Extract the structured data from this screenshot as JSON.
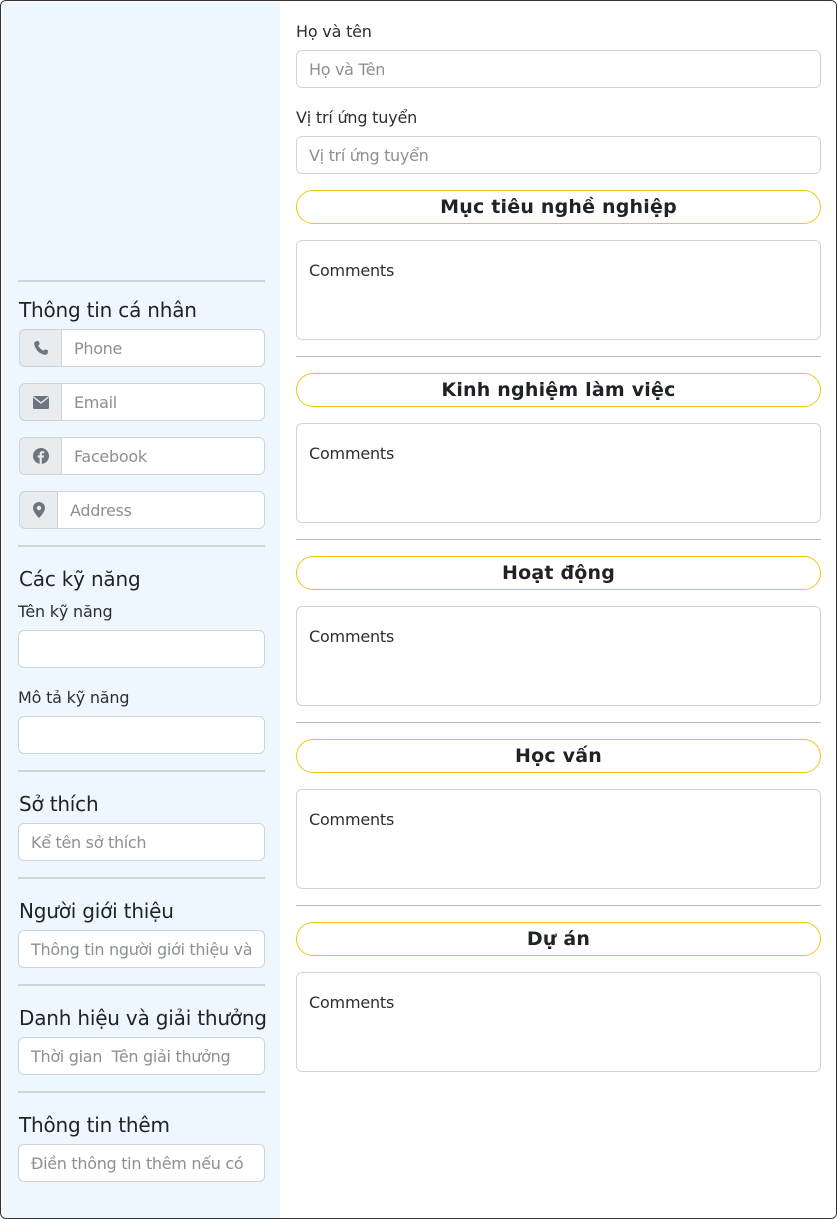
{
  "sidebar": {
    "personal_title": "Thông tin cá nhân",
    "contact": {
      "phone_placeholder": "Phone",
      "email_placeholder": "Email",
      "facebook_placeholder": "Facebook",
      "address_placeholder": "Address",
      "icons": [
        "phone-icon",
        "envelope-icon",
        "facebook-icon",
        "map-marker-icon"
      ]
    },
    "skills": {
      "title": "Các kỹ năng",
      "name_label": "Tên kỹ năng",
      "desc_label": "Mô tả kỹ năng"
    },
    "hobbies": {
      "title": "Sở thích",
      "placeholder": "Kể tên sở thích"
    },
    "referrer": {
      "title": "Người giới thiệu",
      "placeholder": "Thông tin người giới thiệu và t"
    },
    "awards": {
      "title": "Danh hiệu và giải thưởng",
      "placeholder": "Thời gian  Tên giải thưởng"
    },
    "extra": {
      "title": "Thông tin thêm",
      "placeholder": "Điền thông tin thêm nếu có"
    }
  },
  "main": {
    "fullname_label": "Họ và tên",
    "fullname_placeholder": "Họ và Tên",
    "position_label": "Vị trí ứng tuyển",
    "position_placeholder": "Vị trí ứng tuyển",
    "sections": [
      {
        "title": "Mục tiêu nghề nghiệp",
        "comment": "Comments"
      },
      {
        "title": "Kinh nghiệm làm việc",
        "comment": "Comments"
      },
      {
        "title": "Hoạt động",
        "comment": "Comments"
      },
      {
        "title": "Học vấn",
        "comment": "Comments"
      },
      {
        "title": "Dự án",
        "comment": "Comments"
      }
    ]
  },
  "colors": {
    "sidebar_bg": "#eef6fe",
    "pill_border": "#f0c419",
    "input_border": "#ced4da"
  }
}
